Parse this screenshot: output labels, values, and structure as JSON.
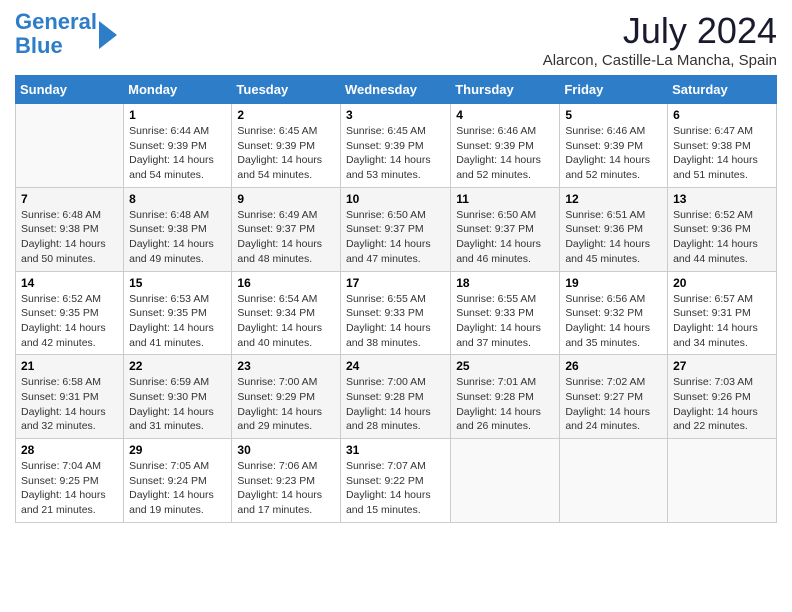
{
  "header": {
    "logo_line1": "General",
    "logo_line2": "Blue",
    "month_title": "July 2024",
    "location": "Alarcon, Castille-La Mancha, Spain"
  },
  "weekdays": [
    "Sunday",
    "Monday",
    "Tuesday",
    "Wednesday",
    "Thursday",
    "Friday",
    "Saturday"
  ],
  "weeks": [
    [
      {
        "day": "",
        "sunrise": "",
        "sunset": "",
        "daylight": ""
      },
      {
        "day": "1",
        "sunrise": "6:44 AM",
        "sunset": "9:39 PM",
        "daylight": "14 hours and 54 minutes."
      },
      {
        "day": "2",
        "sunrise": "6:45 AM",
        "sunset": "9:39 PM",
        "daylight": "14 hours and 54 minutes."
      },
      {
        "day": "3",
        "sunrise": "6:45 AM",
        "sunset": "9:39 PM",
        "daylight": "14 hours and 53 minutes."
      },
      {
        "day": "4",
        "sunrise": "6:46 AM",
        "sunset": "9:39 PM",
        "daylight": "14 hours and 52 minutes."
      },
      {
        "day": "5",
        "sunrise": "6:46 AM",
        "sunset": "9:39 PM",
        "daylight": "14 hours and 52 minutes."
      },
      {
        "day": "6",
        "sunrise": "6:47 AM",
        "sunset": "9:38 PM",
        "daylight": "14 hours and 51 minutes."
      }
    ],
    [
      {
        "day": "7",
        "sunrise": "6:48 AM",
        "sunset": "9:38 PM",
        "daylight": "14 hours and 50 minutes."
      },
      {
        "day": "8",
        "sunrise": "6:48 AM",
        "sunset": "9:38 PM",
        "daylight": "14 hours and 49 minutes."
      },
      {
        "day": "9",
        "sunrise": "6:49 AM",
        "sunset": "9:37 PM",
        "daylight": "14 hours and 48 minutes."
      },
      {
        "day": "10",
        "sunrise": "6:50 AM",
        "sunset": "9:37 PM",
        "daylight": "14 hours and 47 minutes."
      },
      {
        "day": "11",
        "sunrise": "6:50 AM",
        "sunset": "9:37 PM",
        "daylight": "14 hours and 46 minutes."
      },
      {
        "day": "12",
        "sunrise": "6:51 AM",
        "sunset": "9:36 PM",
        "daylight": "14 hours and 45 minutes."
      },
      {
        "day": "13",
        "sunrise": "6:52 AM",
        "sunset": "9:36 PM",
        "daylight": "14 hours and 44 minutes."
      }
    ],
    [
      {
        "day": "14",
        "sunrise": "6:52 AM",
        "sunset": "9:35 PM",
        "daylight": "14 hours and 42 minutes."
      },
      {
        "day": "15",
        "sunrise": "6:53 AM",
        "sunset": "9:35 PM",
        "daylight": "14 hours and 41 minutes."
      },
      {
        "day": "16",
        "sunrise": "6:54 AM",
        "sunset": "9:34 PM",
        "daylight": "14 hours and 40 minutes."
      },
      {
        "day": "17",
        "sunrise": "6:55 AM",
        "sunset": "9:33 PM",
        "daylight": "14 hours and 38 minutes."
      },
      {
        "day": "18",
        "sunrise": "6:55 AM",
        "sunset": "9:33 PM",
        "daylight": "14 hours and 37 minutes."
      },
      {
        "day": "19",
        "sunrise": "6:56 AM",
        "sunset": "9:32 PM",
        "daylight": "14 hours and 35 minutes."
      },
      {
        "day": "20",
        "sunrise": "6:57 AM",
        "sunset": "9:31 PM",
        "daylight": "14 hours and 34 minutes."
      }
    ],
    [
      {
        "day": "21",
        "sunrise": "6:58 AM",
        "sunset": "9:31 PM",
        "daylight": "14 hours and 32 minutes."
      },
      {
        "day": "22",
        "sunrise": "6:59 AM",
        "sunset": "9:30 PM",
        "daylight": "14 hours and 31 minutes."
      },
      {
        "day": "23",
        "sunrise": "7:00 AM",
        "sunset": "9:29 PM",
        "daylight": "14 hours and 29 minutes."
      },
      {
        "day": "24",
        "sunrise": "7:00 AM",
        "sunset": "9:28 PM",
        "daylight": "14 hours and 28 minutes."
      },
      {
        "day": "25",
        "sunrise": "7:01 AM",
        "sunset": "9:28 PM",
        "daylight": "14 hours and 26 minutes."
      },
      {
        "day": "26",
        "sunrise": "7:02 AM",
        "sunset": "9:27 PM",
        "daylight": "14 hours and 24 minutes."
      },
      {
        "day": "27",
        "sunrise": "7:03 AM",
        "sunset": "9:26 PM",
        "daylight": "14 hours and 22 minutes."
      }
    ],
    [
      {
        "day": "28",
        "sunrise": "7:04 AM",
        "sunset": "9:25 PM",
        "daylight": "14 hours and 21 minutes."
      },
      {
        "day": "29",
        "sunrise": "7:05 AM",
        "sunset": "9:24 PM",
        "daylight": "14 hours and 19 minutes."
      },
      {
        "day": "30",
        "sunrise": "7:06 AM",
        "sunset": "9:23 PM",
        "daylight": "14 hours and 17 minutes."
      },
      {
        "day": "31",
        "sunrise": "7:07 AM",
        "sunset": "9:22 PM",
        "daylight": "14 hours and 15 minutes."
      },
      {
        "day": "",
        "sunrise": "",
        "sunset": "",
        "daylight": ""
      },
      {
        "day": "",
        "sunrise": "",
        "sunset": "",
        "daylight": ""
      },
      {
        "day": "",
        "sunrise": "",
        "sunset": "",
        "daylight": ""
      }
    ]
  ]
}
